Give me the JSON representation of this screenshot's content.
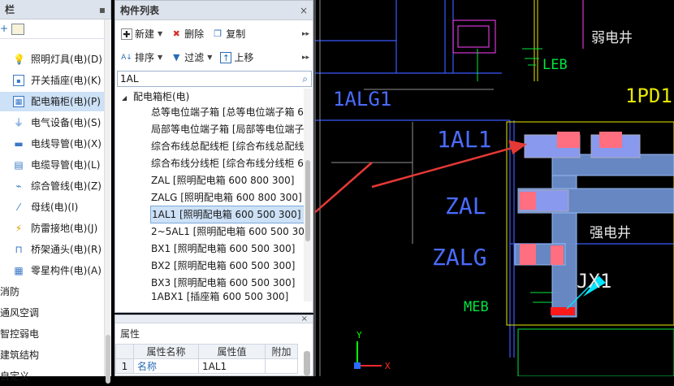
{
  "left_panel": {
    "title_partial": "栏",
    "items": [
      {
        "label": "照明灯具(电)(D)",
        "icon": "lamp-icon"
      },
      {
        "label": "开关插座(电)(K)",
        "icon": "socket-icon"
      },
      {
        "label": "配电箱柜(电)(P)",
        "icon": "distribution-box-icon",
        "selected": true
      },
      {
        "label": "电气设备(电)(S)",
        "icon": "electrical-device-icon"
      },
      {
        "label": "电线导管(电)(X)",
        "icon": "wire-conduit-icon"
      },
      {
        "label": "电缆导管(电)(L)",
        "icon": "cable-conduit-icon"
      },
      {
        "label": "综合管线(电)(Z)",
        "icon": "pipeline-icon"
      },
      {
        "label": "母线(电)(I)",
        "icon": "busbar-icon"
      },
      {
        "label": "防雷接地(电)(J)",
        "icon": "lightning-ground-icon"
      },
      {
        "label": "桥架通头(电)(R)",
        "icon": "tray-fitting-icon"
      },
      {
        "label": "零星构件(电)(A)",
        "icon": "misc-component-icon"
      }
    ],
    "categories": [
      "消防",
      "通风空调",
      "智控弱电",
      "建筑结构",
      "自定义"
    ]
  },
  "component_list": {
    "title": "构件列表",
    "toolbar1": {
      "new": "新建",
      "delete": "删除",
      "copy": "复制"
    },
    "toolbar2": {
      "sort": "排序",
      "filter": "过滤",
      "move_up": "上移"
    },
    "search_value": "1AL",
    "tree_root": "配电箱柜(电)",
    "items": [
      "总等电位端子箱 [总等电位端子箱 6",
      "局部等电位端子箱 [局部等电位端子",
      "综合布线总配线柜 [综合布线总配线",
      "综合布线分线柜 [综合布线分线柜 6",
      "ZAL [照明配电箱 600 800 300]",
      "ZALG [照明配电箱 600 800 300]",
      "1AL1 [照明配电箱 600 500 300]",
      "2~5AL1 [照明配电箱 600 500 300",
      "BX1 [照明配电箱 600 500 300]",
      "BX2 [照明配电箱 600 500 300]",
      "BX3 [照明配电箱 600 500 300]",
      "1ABX1 [插座箱 600 500 300]"
    ],
    "selected_index": 6
  },
  "properties": {
    "title": "属性",
    "columns": [
      "属性名称",
      "属性值",
      "附加"
    ],
    "rows": [
      {
        "num": "1",
        "name": "名称",
        "value": "1AL1"
      }
    ]
  },
  "cad": {
    "labels": {
      "weak_shaft": "弱电井",
      "leb": "LEB",
      "alg1": "1ALG1",
      "pd1": "1PD1",
      "al1": "1AL1",
      "zal": "ZAL",
      "zalg": "ZALG",
      "strong_shaft": "强电井",
      "jx1": "JX1",
      "meb": "MEB",
      "axis_y": "Y",
      "axis_x": "X"
    },
    "colors": {
      "highlight": "#ff4040",
      "arrow": "#e53935",
      "cyan": "#00e5ff",
      "green": "#00e640",
      "yellow": "#e8e800"
    }
  }
}
